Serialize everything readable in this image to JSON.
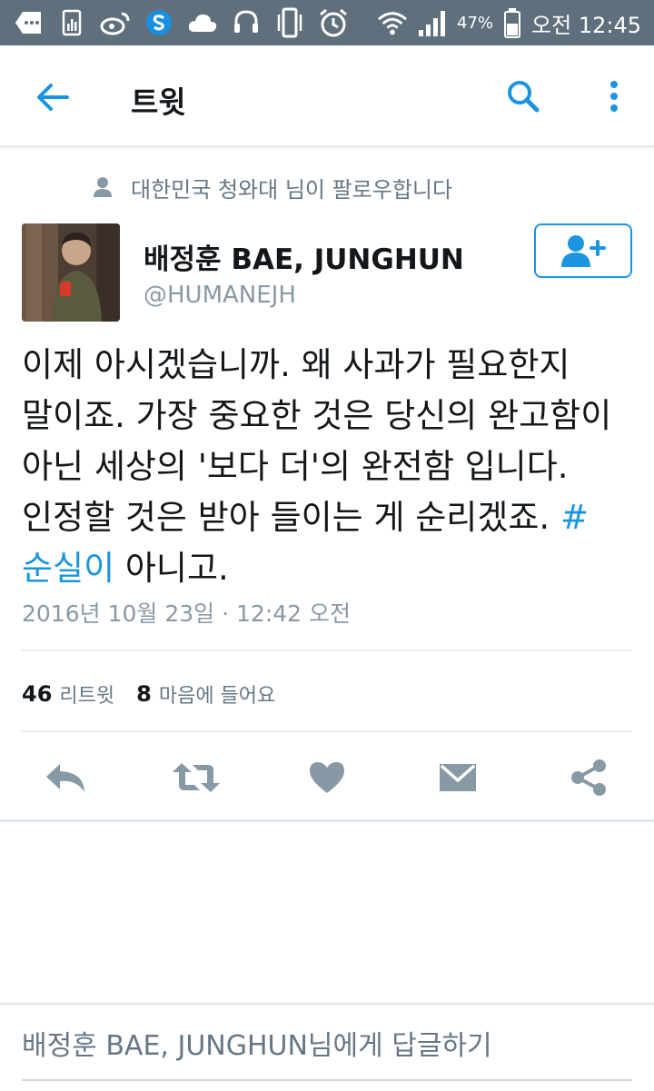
{
  "status_bar": {
    "battery_percent": "47%",
    "time": "오전 12:45",
    "icons": [
      "message-icon",
      "chart-app-icon",
      "weibo-icon",
      "skype-icon",
      "cloud-icon",
      "headset-icon",
      "vibrate-icon",
      "alarm-icon",
      "wifi-icon",
      "signal-icon",
      "battery-icon"
    ]
  },
  "appbar": {
    "title": "트윗",
    "icons": [
      "back-arrow-icon",
      "search-icon",
      "more-vert-icon"
    ]
  },
  "context": {
    "text": "대한민국 청와대 님이 팔로우합니다",
    "icon": "person-icon"
  },
  "author": {
    "name": "배정훈 BAE, JUNGHUN",
    "handle": "@HUMANEJH",
    "follow_icon": "add-user-icon"
  },
  "tweet": {
    "text": "이제 아시겠습니까. 왜 사과가 필요한지 말이죠. 가장 중요한 것은 당신의 완고함이 아닌 세상의 '보다 더'의 완전함 입니다. 인정할 것은 받아 들이는 게 순리겠죠. ",
    "hashtag": "#순실이",
    "text_after": " 아니고.",
    "timestamp": "2016년 10월 23일 · 12:42 오전"
  },
  "stats": {
    "retweets_count": "46",
    "retweets_label": "리트윗",
    "likes_count": "8",
    "likes_label": "마음에 들어요"
  },
  "actions": [
    "reply-icon",
    "retweet-icon",
    "heart-icon",
    "message-icon",
    "share-icon"
  ],
  "reply": {
    "author": "배정훈 BAE, JUNGHUN",
    "label": " 님에게 답글하기"
  },
  "colors": {
    "status_bar": "#5f6f7c",
    "accent": "#1b95e0",
    "secondary_text": "#657786",
    "icon_gray": "#8899a6"
  }
}
